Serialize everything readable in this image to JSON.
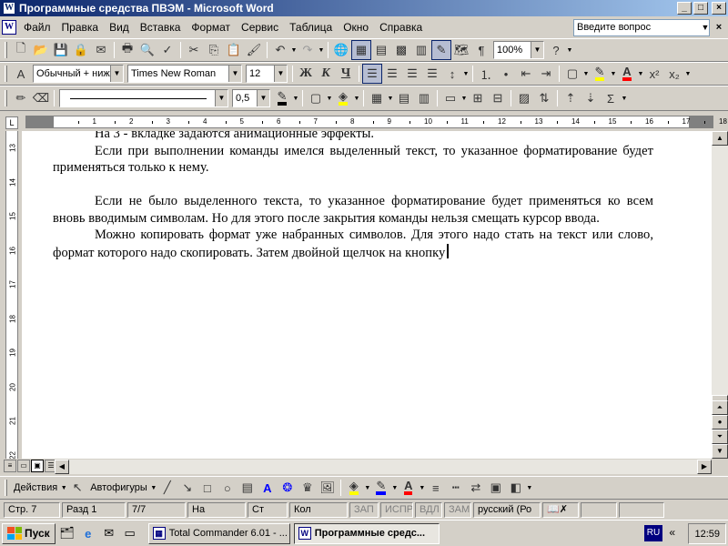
{
  "window": {
    "title": "Программные средства ПВЭМ - Microsoft Word",
    "minimize": "_",
    "maximize": "□",
    "close": "×"
  },
  "menu": {
    "items": [
      "Файл",
      "Правка",
      "Вид",
      "Вставка",
      "Формат",
      "Сервис",
      "Таблица",
      "Окно",
      "Справка"
    ],
    "ask_placeholder": "Введите вопрос"
  },
  "formatting": {
    "style": "Обычный + ниж",
    "font": "Times New Roman",
    "size": "12",
    "bold": "Ж",
    "italic": "К",
    "underline": "Ч"
  },
  "standard": {
    "zoom": "100%"
  },
  "tables_borders": {
    "line_weight": "0,5"
  },
  "ruler": {
    "numbers": [
      "1",
      "2",
      "3",
      "4",
      "5",
      "6",
      "7",
      "8",
      "9",
      "10",
      "11",
      "12",
      "13",
      "14",
      "15",
      "16",
      "17",
      "18"
    ],
    "vertical_numbers": [
      "13",
      "14",
      "15",
      "16",
      "17",
      "18",
      "19",
      "20",
      "21",
      "22"
    ]
  },
  "document": {
    "paragraphs": [
      "На 3 - вкладке задаются анимационные эффекты.",
      "Если при выполнении команды имелся выделенный текст, то указанное форматирование будет применяться только к нему.",
      "",
      "Если не было выделенного текста, то указанное форматирование будет применяться ко всем вновь вводимым символам. Но для этого после закрытия команды нельзя смещать курсор ввода.",
      "Можно копировать формат уже набранных символов. Для этого надо стать на текст или слово, формат которого надо скопировать. Затем двойной щелчок на кнопку"
    ]
  },
  "drawing": {
    "actions": "Действия",
    "autoshapes": "Автофигуры"
  },
  "status": {
    "page": "Стр. 7",
    "section": "Разд 1",
    "pages": "7/7",
    "at": "На",
    "line": "Ст",
    "col": "Кол",
    "rec": "ЗАП",
    "trk": "ИСПР",
    "ext": "ВДЛ",
    "ovr": "ЗАМ",
    "language": "русский (Ро"
  },
  "taskbar": {
    "start": "Пуск",
    "tasks": [
      "Total Commander 6.01 - ...",
      "Программные средс..."
    ],
    "lang": "RU",
    "tray_arrow": "«",
    "clock": "12:59"
  },
  "colors": {
    "title_start": "#0a246a",
    "title_end": "#a6caf0",
    "highlight": "#ffff00",
    "font_color": "#ff0000",
    "line_color": "#0000ff"
  }
}
